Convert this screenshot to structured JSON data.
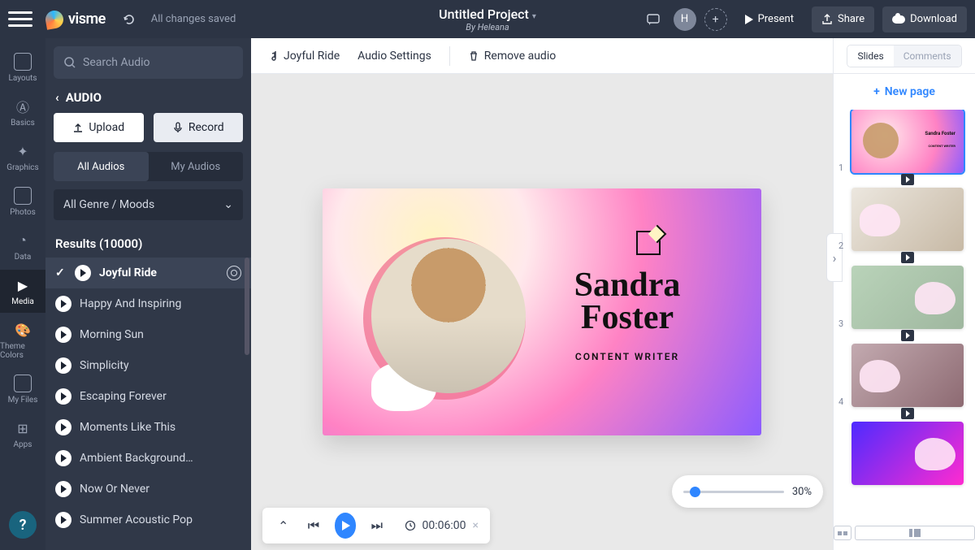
{
  "topbar": {
    "logo_text": "visme",
    "saved_text": "All changes saved",
    "project_title": "Untitled Project",
    "project_by": "By Heleana",
    "avatar_initial": "H",
    "present": "Present",
    "share": "Share",
    "download": "Download"
  },
  "rail": {
    "items": [
      {
        "label": "Layouts"
      },
      {
        "label": "Basics"
      },
      {
        "label": "Graphics"
      },
      {
        "label": "Photos"
      },
      {
        "label": "Data"
      },
      {
        "label": "Media"
      },
      {
        "label": "Theme Colors"
      },
      {
        "label": "My Files"
      },
      {
        "label": "Apps"
      }
    ],
    "help": "?"
  },
  "panel": {
    "search_placeholder": "Search Audio",
    "back_label": "AUDIO",
    "upload": "Upload",
    "record": "Record",
    "tab_all": "All Audios",
    "tab_my": "My Audios",
    "genre": "All Genre / Moods",
    "results": "Results (10000)",
    "tracks": [
      "Joyful Ride",
      "Happy And Inspiring",
      "Morning Sun",
      "Simplicity",
      "Escaping Forever",
      "Moments Like This",
      "Ambient Background…",
      "Now Or Never",
      "Summer Acoustic Pop"
    ]
  },
  "contextbar": {
    "track": "Joyful Ride",
    "settings": "Audio Settings",
    "remove": "Remove audio"
  },
  "slide": {
    "name": "Sandra Foster",
    "role": "CONTENT WRITER"
  },
  "timeline": {
    "time": "00:06:00",
    "zoom": "30%"
  },
  "right": {
    "tab_slides": "Slides",
    "tab_comments": "Comments",
    "newpage": "New page",
    "slide_count": 5,
    "thumb1_name": "Sandra Foster",
    "thumb1_sub": "CONTENT WRITER"
  }
}
